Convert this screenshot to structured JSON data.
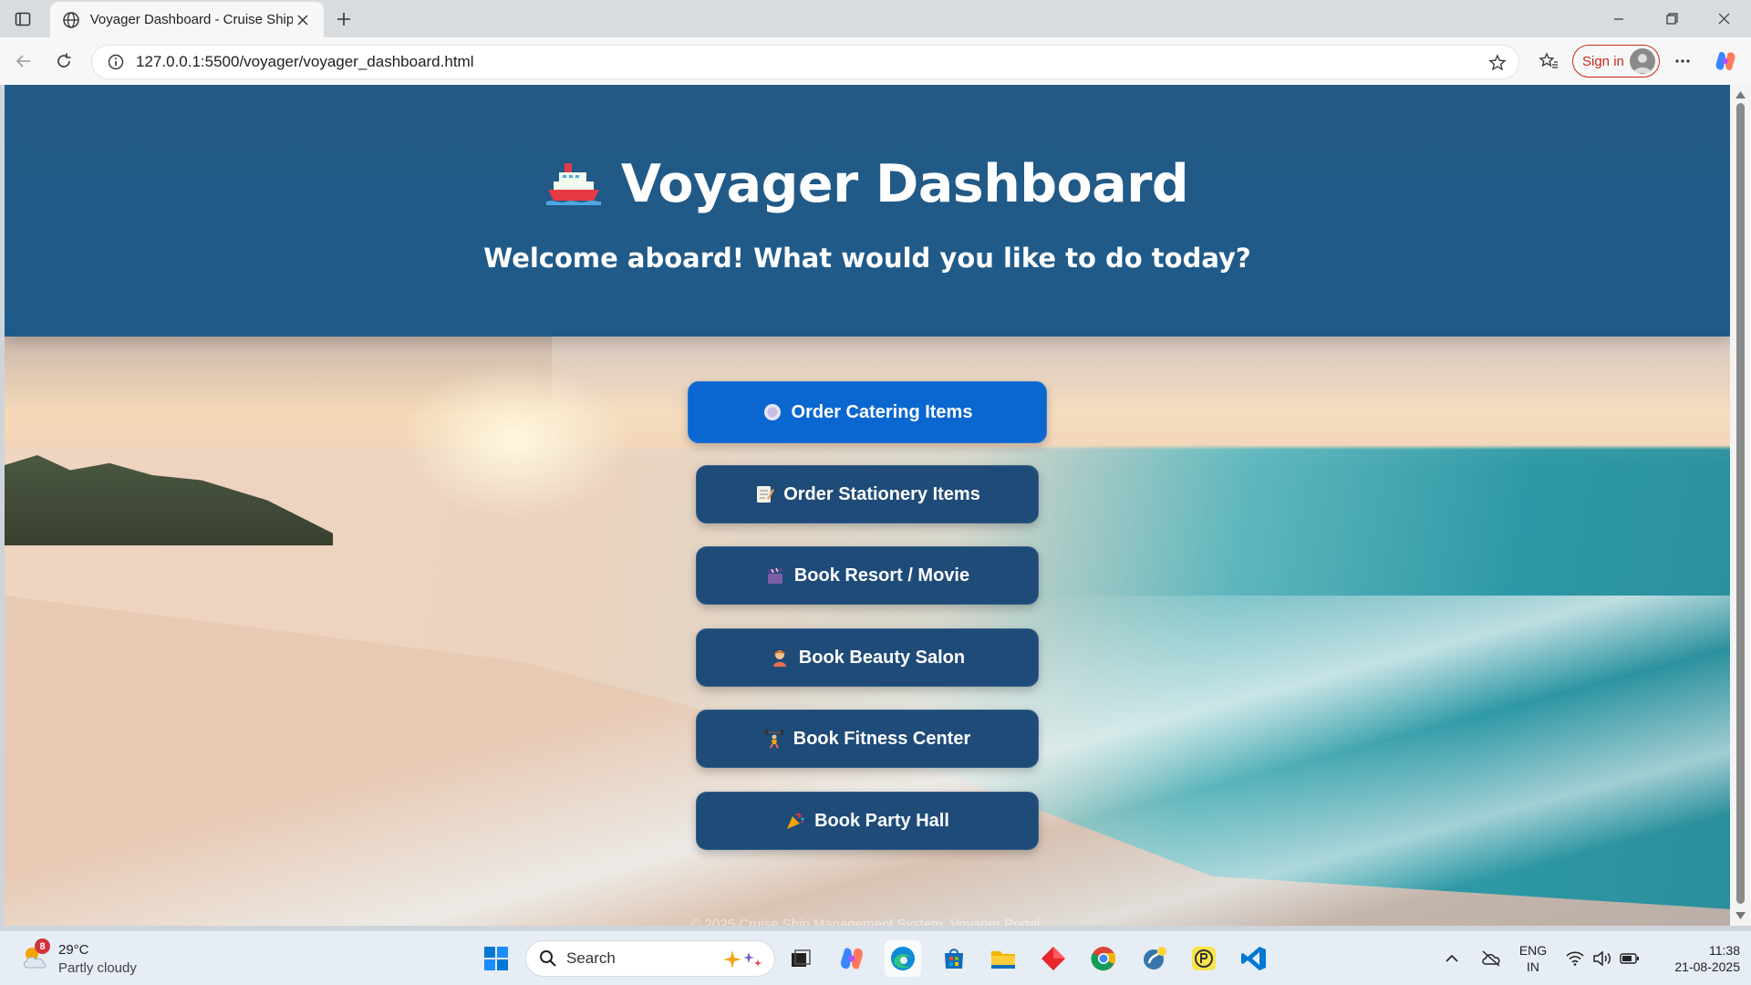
{
  "browser": {
    "tab_title": "Voyager Dashboard - Cruise Ship",
    "url": "127.0.0.1:5500/voyager/voyager_dashboard.html",
    "signin_label": "Sign in"
  },
  "page": {
    "title": "Voyager Dashboard",
    "subtitle": "Welcome aboard! What would you like to do today?",
    "buttons": [
      {
        "label": "Order Catering Items",
        "icon": "plate-icon"
      },
      {
        "label": "Order Stationery Items",
        "icon": "memo-icon"
      },
      {
        "label": "Book Resort / Movie",
        "icon": "clapper-icon"
      },
      {
        "label": "Book Beauty Salon",
        "icon": "haircut-icon"
      },
      {
        "label": "Book Fitness Center",
        "icon": "weightlifter-icon"
      },
      {
        "label": "Book Party Hall",
        "icon": "party-popper-icon"
      }
    ],
    "footer": "© 2025 Cruise Ship Management System. Voyager Portal."
  },
  "taskbar": {
    "weather_temp": "29°C",
    "weather_condition": "Partly cloudy",
    "weather_badge": "8",
    "search_label": "Search",
    "lang_top": "ENG",
    "lang_bottom": "IN",
    "time": "11:38",
    "date": "21-08-2025"
  },
  "colors": {
    "hero": "#215a87",
    "button": "#1e4b78",
    "button_active": "#0b67d0",
    "signin_accent": "#c42b1c"
  }
}
